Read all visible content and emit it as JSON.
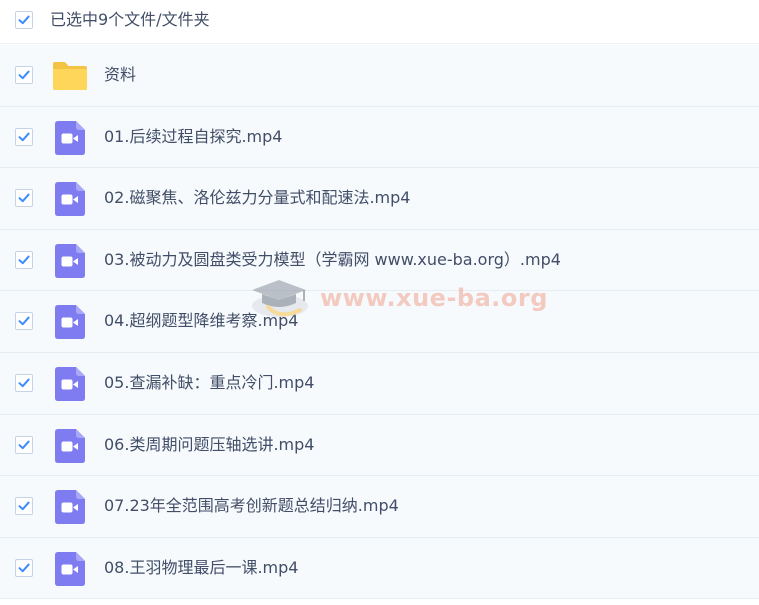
{
  "header": {
    "selected_label": "已选中9个文件/文件夹",
    "checked": true
  },
  "colors": {
    "checkmark": "#3b8cff",
    "row_bg": "#f6fafd",
    "folder": "#fdd65a",
    "video_icon": "#7f7cf2",
    "text": "#424e67",
    "watermark": "#f2a38e"
  },
  "files": [
    {
      "name": "资料",
      "type": "folder",
      "icon": "folder-icon",
      "checked": true
    },
    {
      "name": "01.后续过程自探究.mp4",
      "type": "video",
      "icon": "video-file-icon",
      "checked": true
    },
    {
      "name": "02.磁聚焦、洛伦兹力分量式和配速法.mp4",
      "type": "video",
      "icon": "video-file-icon",
      "checked": true
    },
    {
      "name": "03.被动力及圆盘类受力模型（学霸网 www.xue-ba.org）.mp4",
      "type": "video",
      "icon": "video-file-icon",
      "checked": true
    },
    {
      "name": "04.超纲题型降维考察.mp4",
      "type": "video",
      "icon": "video-file-icon",
      "checked": true
    },
    {
      "name": "05.查漏补缺：重点冷门.mp4",
      "type": "video",
      "icon": "video-file-icon",
      "checked": true
    },
    {
      "name": "06.类周期问题压轴选讲.mp4",
      "type": "video",
      "icon": "video-file-icon",
      "checked": true
    },
    {
      "name": "07.23年全范围高考创新题总结归纳.mp4",
      "type": "video",
      "icon": "video-file-icon",
      "checked": true
    },
    {
      "name": "08.王羽物理最后一课.mp4",
      "type": "video",
      "icon": "video-file-icon",
      "checked": true
    }
  ],
  "watermark": {
    "text": "www.xue-ba.org",
    "icon": "graduation-cap-icon"
  }
}
